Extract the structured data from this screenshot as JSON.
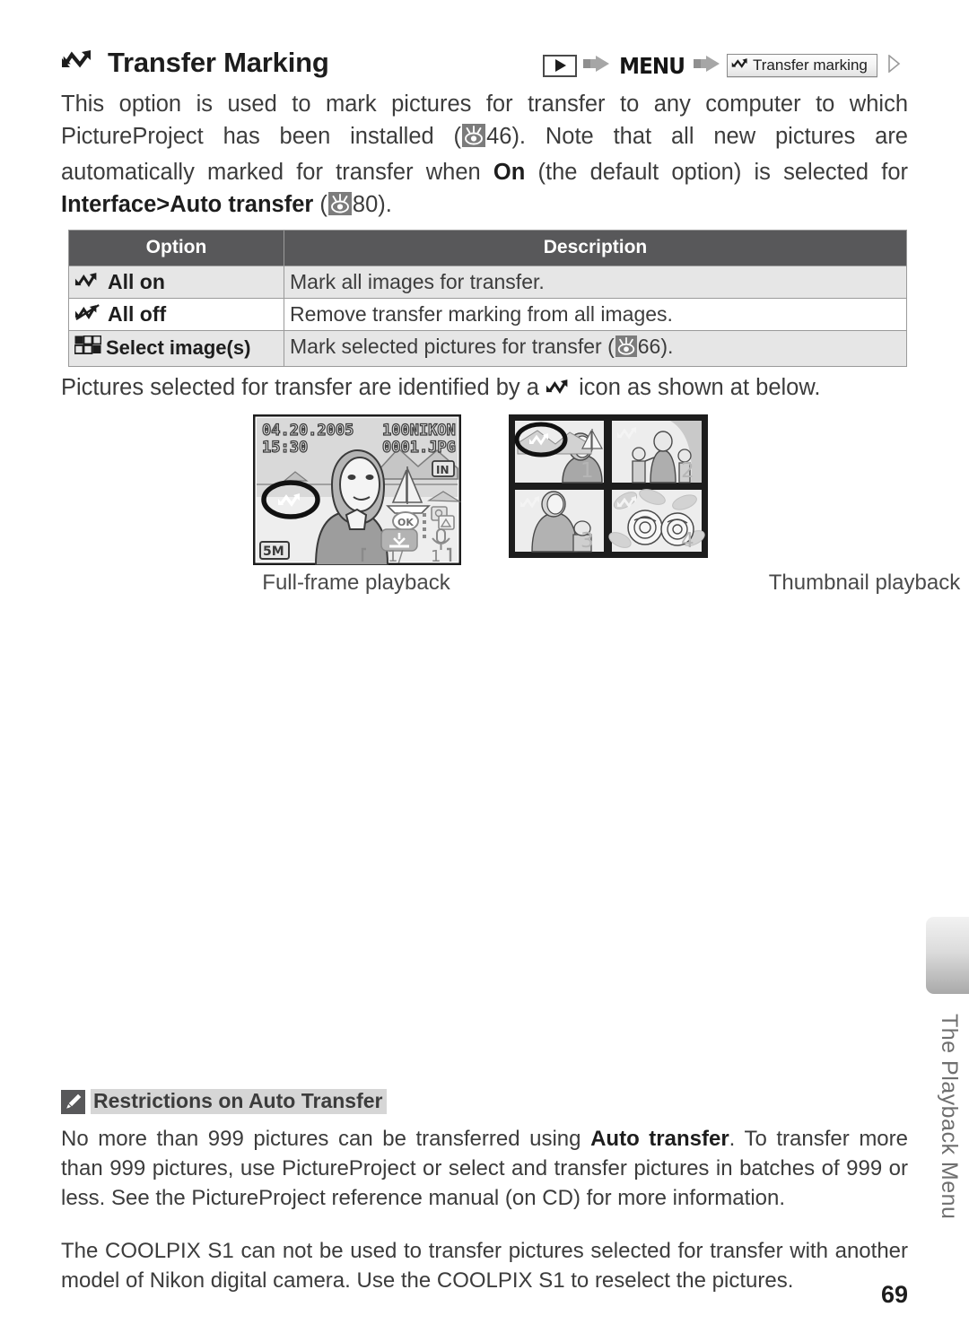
{
  "header": {
    "title": "Transfer Marking",
    "title_icon": "transfer-arrow-icon"
  },
  "breadcrumb": {
    "play_button_icon": "playback-mode-icon",
    "arrow_icon": "right-arrow-icon",
    "menu_label": "MENU",
    "field_icon": "transfer-arrow-icon",
    "field_label": "Transfer marking",
    "chevron_icon": "chevron-right-icon"
  },
  "intro": {
    "part1": "This option is used to mark pictures for transfer to any computer to which PictureProject has been installed (",
    "ref1_icon": "eye-reference-icon",
    "ref1_page": "46",
    "part2": "). Note that all new pictures are automatically marked for transfer when ",
    "bold_on": "On",
    "part3": " (the default option) is selected for ",
    "bold_path": "Interface",
    "path_sep": ">",
    "bold_path2": "Auto transfer",
    "part4": " (",
    "ref2_icon": "eye-reference-icon",
    "ref2_page": "80",
    "part5": ")."
  },
  "options_table": {
    "headers": [
      "Option",
      "Description"
    ],
    "rows": [
      {
        "icon": "transfer-all-on-icon",
        "option": "All on",
        "description": "Mark all images for transfer."
      },
      {
        "icon": "transfer-all-off-icon",
        "option": "All off",
        "description": "Remove transfer marking from all images."
      },
      {
        "icon": "thumbnail-grid-icon",
        "option": "Select image(s)",
        "description_pre": "Mark selected pictures for transfer (",
        "description_ref_icon": "eye-reference-icon",
        "description_ref_page": "66",
        "description_post": ")."
      }
    ]
  },
  "selected_line": {
    "pre": "Pictures selected for transfer are identified by a ",
    "icon": "transfer-arrow-icon",
    "post": " icon as shown at below."
  },
  "figures": {
    "full_frame": {
      "caption": "Full-frame playback",
      "date": "04.20.2005",
      "time": "15:30",
      "folder": "100NIKON",
      "filename": "0001.JPG",
      "memory_badge": "IN",
      "quality_badge": "5M",
      "frame_counter_left": "1/",
      "frame_counter_right": "1",
      "ok_label": "OK",
      "transfer_mark_icon": "transfer-arrow-icon",
      "print_icon": "print-icon",
      "mic_icon": "microphone-icon",
      "download_icon": "transfer-download-icon"
    },
    "thumbnail": {
      "caption": "Thumbnail playback",
      "numbers": [
        "1",
        "2",
        "3",
        "4"
      ],
      "transfer_mark_icon": "transfer-arrow-icon"
    }
  },
  "note": {
    "icon": "pencil-note-icon",
    "title": "Restrictions on Auto Transfer",
    "paragraph1_pre": "No more than 999 pictures can be transferred using ",
    "paragraph1_bold": "Auto transfer",
    "paragraph1_post": ". To transfer more than 999 pictures, use PictureProject or select and transfer pictures in batches of 999 or less. See the PictureProject reference manual (on CD) for more information.",
    "paragraph2": "The COOLPIX S1 can not be used to transfer pictures selected for transfer with another model of Nikon digital camera. Use the COOLPIX S1 to reselect the pictures."
  },
  "side_tab": {
    "label": "The Playback Menu"
  },
  "footer": {
    "page_number": "69"
  },
  "colors": {
    "table_header_bg": "#58585a",
    "row_shade": "#e6e6e6",
    "note_highlight": "#d6d6d6",
    "body_text": "#3c3c3c"
  }
}
